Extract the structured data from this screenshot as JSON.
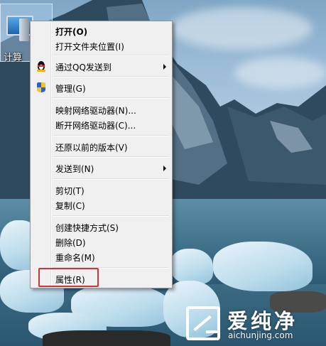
{
  "desktop": {
    "icon_label": "计算"
  },
  "context_menu": {
    "items": [
      {
        "label": "打开(O)",
        "bold": true
      },
      {
        "label": "打开文件夹位置(I)"
      },
      {
        "label": "通过QQ发送到",
        "icon": "qq-icon",
        "submenu": true
      },
      {
        "label": "管理(G)",
        "icon": "shield-icon"
      },
      {
        "label": "映射网络驱动器(N)..."
      },
      {
        "label": "断开网络驱动器(C)..."
      },
      {
        "label": "还原以前的版本(V)"
      },
      {
        "label": "发送到(N)",
        "submenu": true
      },
      {
        "label": "剪切(T)"
      },
      {
        "label": "复制(C)"
      },
      {
        "label": "创建快捷方式(S)"
      },
      {
        "label": "删除(D)"
      },
      {
        "label": "重命名(M)"
      },
      {
        "label": "属性(R)",
        "highlighted": true
      }
    ],
    "highlight_color": "#cf3339"
  },
  "watermark": {
    "title": "爱纯净",
    "url": "aichunjing.com"
  }
}
